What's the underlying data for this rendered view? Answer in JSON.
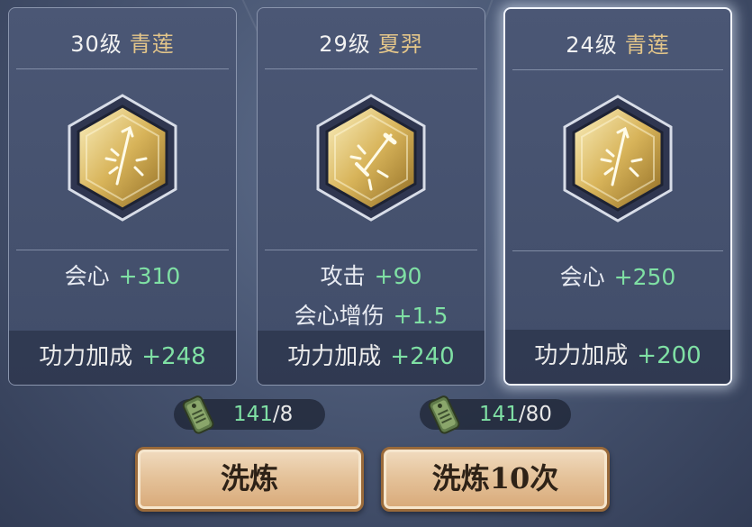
{
  "cards": [
    {
      "level": "30级",
      "school": "青莲",
      "emblem": "arrow-burst-icon",
      "stats": [
        {
          "name": "会心",
          "value": "+310"
        }
      ],
      "bonus": {
        "label": "功力加成",
        "value": "+248"
      },
      "selected": false
    },
    {
      "level": "29级",
      "school": "夏羿",
      "emblem": "sword-burst-icon",
      "stats": [
        {
          "name": "攻击",
          "value": "+90"
        },
        {
          "name": "会心增伤",
          "value": "+1.5"
        }
      ],
      "bonus": {
        "label": "功力加成",
        "value": "+240"
      },
      "selected": false
    },
    {
      "level": "24级",
      "school": "青莲",
      "emblem": "arrow-burst-icon",
      "stats": [
        {
          "name": "会心",
          "value": "+250"
        }
      ],
      "bonus": {
        "label": "功力加成",
        "value": "+200"
      },
      "selected": true
    }
  ],
  "costs": [
    {
      "have": "141",
      "need": "/8",
      "icon": "jade-token-icon"
    },
    {
      "have": "141",
      "need": "/80",
      "icon": "jade-token-icon"
    }
  ],
  "buttons": {
    "refine_once": "洗炼",
    "refine_ten": "洗炼10次"
  },
  "colors": {
    "value_green": "#7fe0a4",
    "school_gold": "#e4c68a",
    "selected_border": "#f2f6ff"
  }
}
